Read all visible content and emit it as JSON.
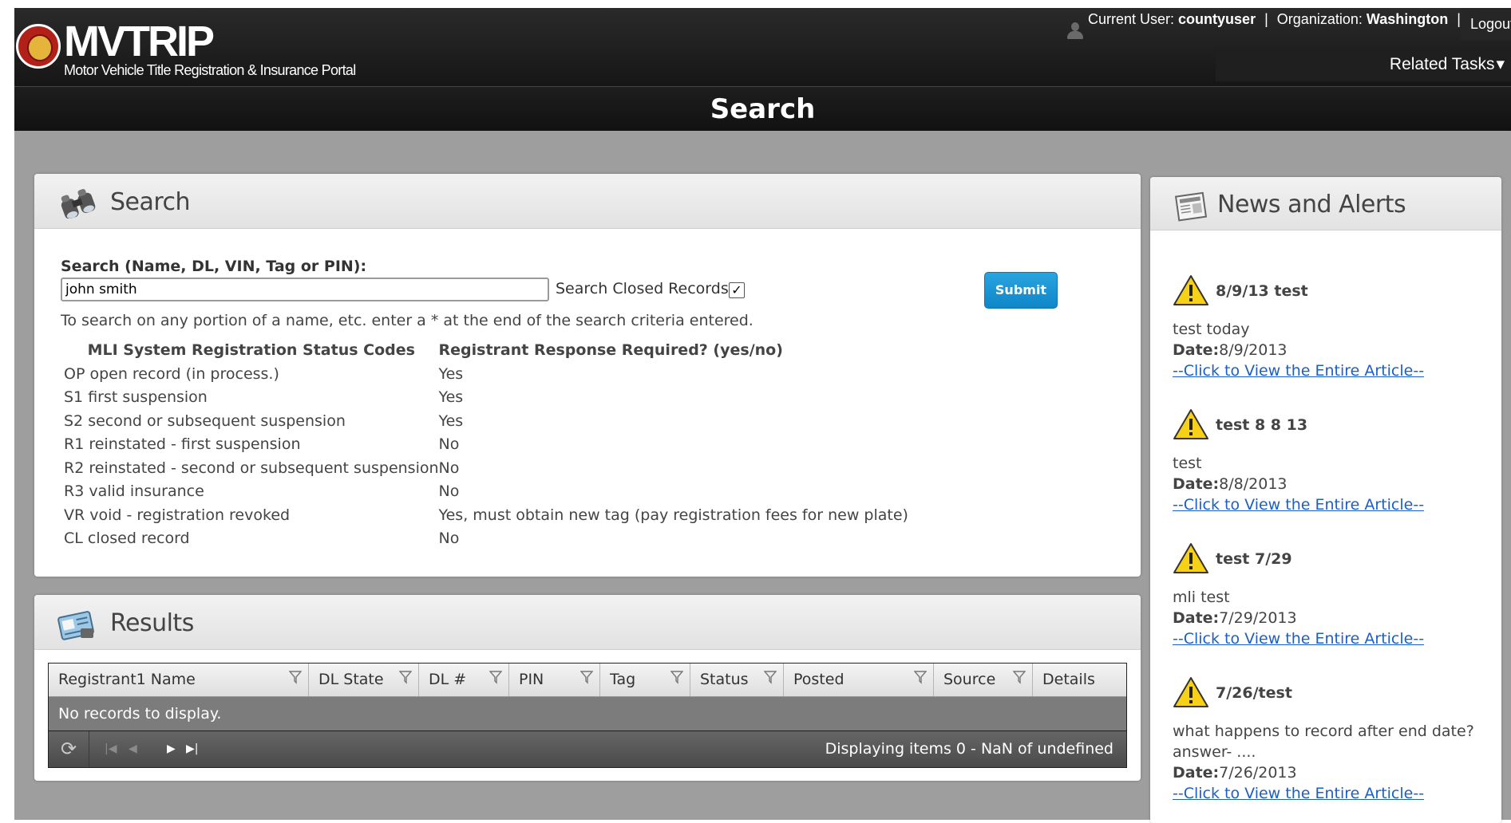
{
  "header": {
    "app_title": "MVTRIP",
    "app_subtitle": "Motor Vehicle Title Registration & Insurance Portal",
    "current_user_label": "Current User:",
    "current_user": "countyuser",
    "organization_label": "Organization:",
    "organization": "Washington",
    "separator": "|",
    "logout_label": "Logout",
    "related_tasks_label": "Related Tasks"
  },
  "page": {
    "title": "Search"
  },
  "search_panel": {
    "title": "Search",
    "search_label": "Search (Name, DL, VIN, Tag or PIN):",
    "search_value": "john smith",
    "closed_records_label": "Search Closed Records:",
    "closed_records_checked": true,
    "submit_label": "Submit",
    "hint": "To search on any portion of a name, etc. enter a * at the end of the search criteria entered.",
    "codes_header": "MLI System Registration Status Codes",
    "response_header": "Registrant Response Required? (yes/no)",
    "codes": [
      {
        "code": "OP open record (in process.)",
        "response": "Yes"
      },
      {
        "code": "S1 first suspension",
        "response": "Yes"
      },
      {
        "code": "S2 second or subsequent suspension",
        "response": "Yes"
      },
      {
        "code": "R1 reinstated - first suspension",
        "response": "No"
      },
      {
        "code": "R2 reinstated - second or subsequent suspension",
        "response": "No"
      },
      {
        "code": "R3 valid insurance",
        "response": "No"
      },
      {
        "code": "VR void - registration revoked",
        "response": "Yes, must obtain new tag (pay registration fees for new plate)"
      },
      {
        "code": "CL closed record",
        "response": "No"
      }
    ]
  },
  "results_panel": {
    "title": "Results",
    "columns": [
      "Registrant1 Name",
      "DL State",
      "DL #",
      "PIN",
      "Tag",
      "Status",
      "Posted",
      "Source",
      "Details"
    ],
    "empty_message": "No records to display.",
    "pager_info": "Displaying items 0 - NaN of undefined"
  },
  "news_panel": {
    "title": "News and Alerts",
    "date_label": "Date:",
    "link_label": "--Click to View the Entire Article--",
    "items": [
      {
        "title": "8/9/13 test",
        "body": "test today",
        "date": "8/9/2013"
      },
      {
        "title": "test 8 8 13",
        "body": "test",
        "date": "8/8/2013"
      },
      {
        "title": "test 7/29",
        "body": "mli test",
        "date": "7/29/2013"
      },
      {
        "title": "7/26/test",
        "body": "what happens to record after end date? answer- ....",
        "date": "7/26/2013"
      }
    ]
  },
  "colors": {
    "header_bg": "#1b1b1b",
    "content_bg": "#9e9e9e",
    "submit_bg": "#1a96d6",
    "link": "#1b5fc7",
    "warning": "#f7d117"
  },
  "icons": {
    "logo": "state-seal-icon",
    "user": "user-icon",
    "search_panel": "binoculars-icon",
    "results_panel": "results-card-icon",
    "news_panel": "newspaper-icon",
    "alert": "warning-icon",
    "filter": "filter-icon",
    "refresh": "refresh-icon"
  }
}
